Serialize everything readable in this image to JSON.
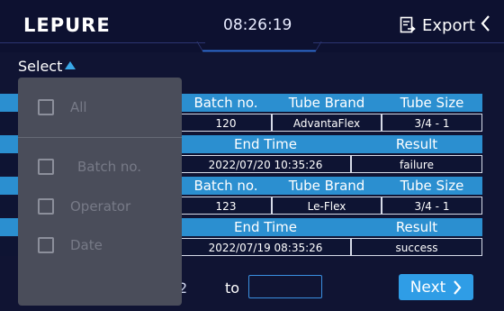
{
  "header": {
    "logo": "LEPURE",
    "clock": "08:26:19",
    "export_label": "Export",
    "back_icon": "‹"
  },
  "select": {
    "label": "Select"
  },
  "table": {
    "records": [
      {
        "head1": [
          "Batch no.",
          "Tube Brand",
          "Tube Size"
        ],
        "val1": [
          "120",
          "AdvantaFlex",
          "3/4 - 1"
        ],
        "head2": [
          "End Time",
          "Result"
        ],
        "val2_left": "0",
        "val2": [
          "2022/07/20 10:35:26",
          "failure"
        ]
      },
      {
        "head1": [
          "Batch no.",
          "Tube Brand",
          "Tube Size"
        ],
        "val1": [
          "123",
          "Le-Flex",
          "3/4 - 1"
        ],
        "head2": [
          "End Time",
          "Result"
        ],
        "val2_left": "0",
        "val2": [
          "2022/07/19 08:35:26",
          "success"
        ]
      }
    ]
  },
  "pager": {
    "page_number": "2",
    "to_label": "to",
    "input_value": "",
    "next_label": "Next"
  },
  "dropdown": {
    "items": [
      "All",
      "Batch no.",
      "Operator",
      "Date"
    ]
  },
  "colors": {
    "background": "#101433",
    "header_row": "#2b8fd0",
    "accent": "#2f9de6",
    "dropdown": "#4a4d5a"
  }
}
